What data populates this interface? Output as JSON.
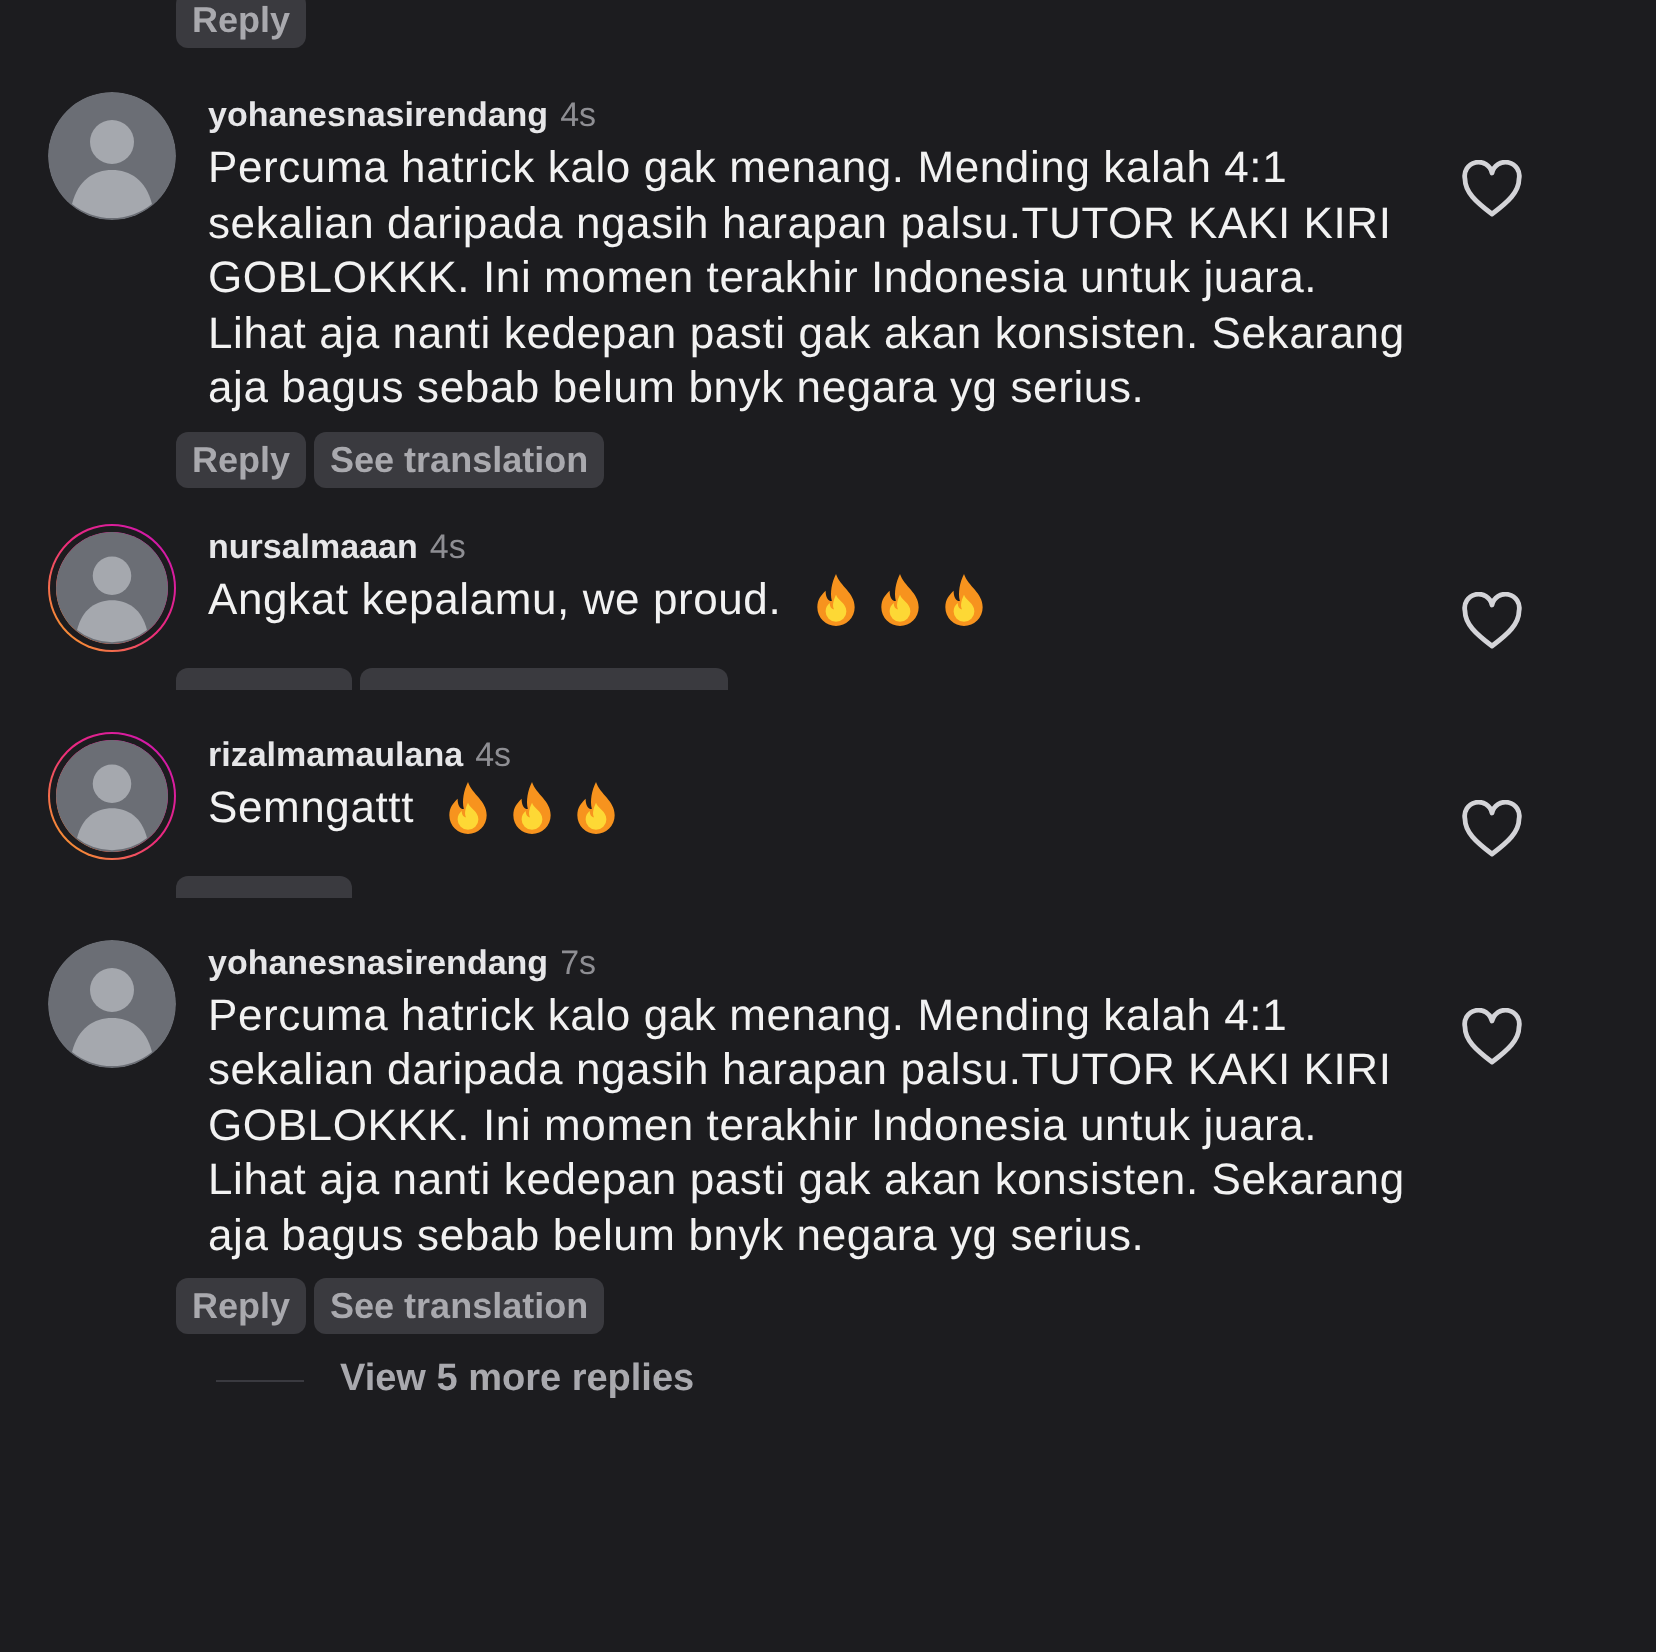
{
  "top_actions": {
    "reply": "Reply"
  },
  "comments": [
    {
      "username": "yohanesnasirendang",
      "time": "4s",
      "text": "Percuma hatrick kalo gak menang. Mending kalah 4:1 sekalian daripada ngasih harapan palsu.TUTOR KAKI KIRI GOBLOKKK. Ini momen terakhir Indonesia untuk juara. Lihat aja nanti kedepan pasti gak akan konsisten. Sekarang aja bagus sebab belum bnyk negara yg serius.",
      "story_ring": false,
      "liked": false,
      "actions_cut": false,
      "actions": [
        {
          "kind": "reply",
          "label": "Reply"
        },
        {
          "kind": "translate",
          "label": "See translation"
        }
      ]
    },
    {
      "username": "nursalmaaan",
      "time": "4s",
      "text": "Angkat kepalamu, we proud.",
      "emojis": [
        {
          "kind": "fire"
        },
        {
          "kind": "fire"
        },
        {
          "kind": "fire"
        }
      ],
      "story_ring": true,
      "liked": false,
      "actions_cut": true,
      "actions": [
        {
          "kind": "reply"
        },
        {
          "kind": "translate"
        }
      ]
    },
    {
      "username": "rizalmamaulana",
      "time": "4s",
      "text": "Semngattt",
      "emojis": [
        {
          "kind": "fire"
        },
        {
          "kind": "fire"
        },
        {
          "kind": "fire"
        }
      ],
      "story_ring": true,
      "liked": false,
      "actions_cut": true,
      "actions": [
        {
          "kind": "reply"
        }
      ]
    },
    {
      "username": "yohanesnasirendang",
      "time": "7s",
      "text": "Percuma hatrick kalo gak menang. Mending kalah 4:1 sekalian daripada ngasih harapan palsu.TUTOR KAKI KIRI GOBLOKKK. Ini momen terakhir Indonesia untuk juara. Lihat aja nanti kedepan pasti gak akan konsisten. Sekarang aja bagus sebab belum bnyk negara yg serius.",
      "story_ring": false,
      "liked": false,
      "actions_cut": false,
      "actions": [
        {
          "kind": "reply",
          "label": "Reply"
        },
        {
          "kind": "translate",
          "label": "See translation"
        }
      ]
    }
  ],
  "more_replies": "View 5 more replies"
}
